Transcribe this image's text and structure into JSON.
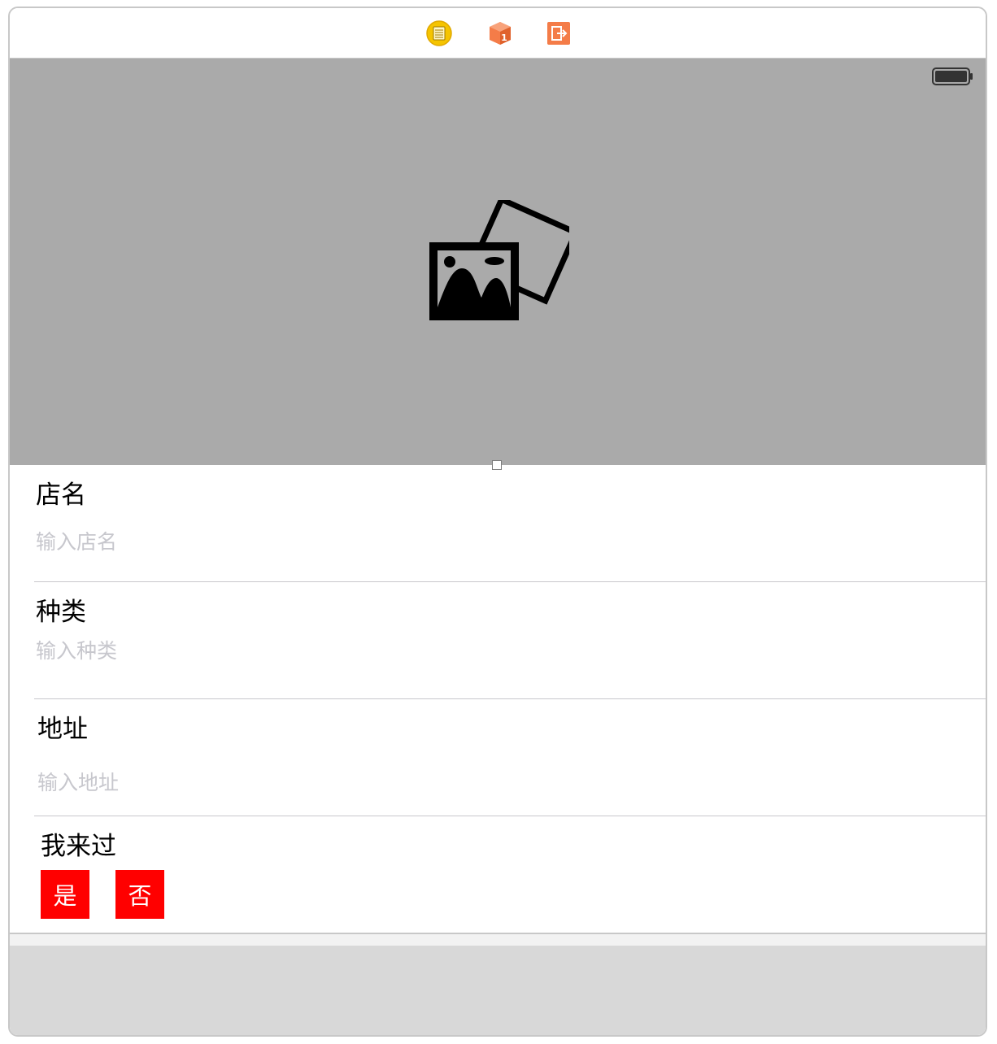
{
  "dock": {
    "icons": [
      "view-controller-icon",
      "first-responder-icon",
      "exit-icon"
    ],
    "colors": {
      "view_controller": "#f5c400",
      "first_responder": "#f47c48",
      "exit": "#f47c48"
    }
  },
  "header": {
    "image_placeholder_icon": "photo-icon",
    "background_color": "#aaaaaa"
  },
  "form": {
    "name": {
      "label": "店名",
      "placeholder": "输入店名"
    },
    "type": {
      "label": "种类",
      "placeholder": "输入种类"
    },
    "address": {
      "label": "地址",
      "placeholder": "输入地址"
    },
    "visited": {
      "label": "我来过",
      "yes_label": "是",
      "no_label": "否",
      "button_color": "#ff0000"
    }
  }
}
